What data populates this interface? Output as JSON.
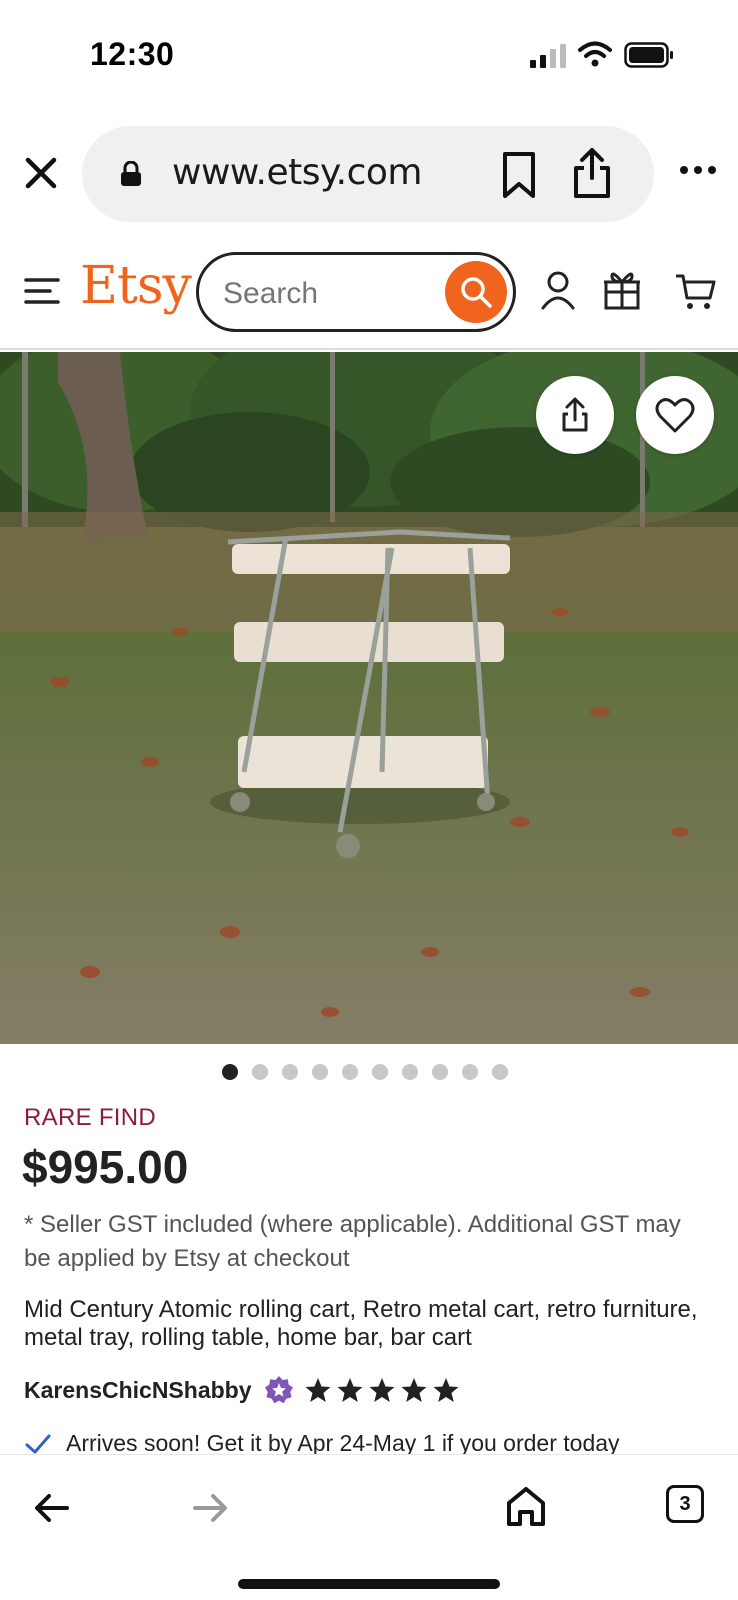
{
  "status_bar": {
    "time": "12:30"
  },
  "browser": {
    "url": "www.etsy.com",
    "tab_count": "3"
  },
  "header": {
    "logo": "Etsy",
    "search_placeholder": "Search",
    "accent_color": "#f1641e"
  },
  "gallery": {
    "image_count": 10,
    "active_index": 0
  },
  "product": {
    "badge": "RARE FIND",
    "price": "$995.00",
    "gst_note": "* Seller GST included (where applicable). Additional GST may be applied by Etsy at checkout",
    "title": "Mid Century Atomic rolling cart, Retro metal cart, retro furniture, metal tray, rolling table, home bar, bar cart",
    "seller": "KarensChicNShabby",
    "rating_stars": 5,
    "arrives": "Arrives soon! Get it by Apr 24-May 1 if you order today"
  },
  "icons": [
    "close-icon",
    "lock-icon",
    "bookmark-icon",
    "share-icon",
    "more-icon",
    "menu-icon",
    "search-icon",
    "user-icon",
    "gift-icon",
    "cart-icon",
    "heart-icon",
    "star-seller-icon",
    "star-icon",
    "check-icon",
    "back-icon",
    "forward-icon",
    "home-icon",
    "tabs-icon"
  ]
}
